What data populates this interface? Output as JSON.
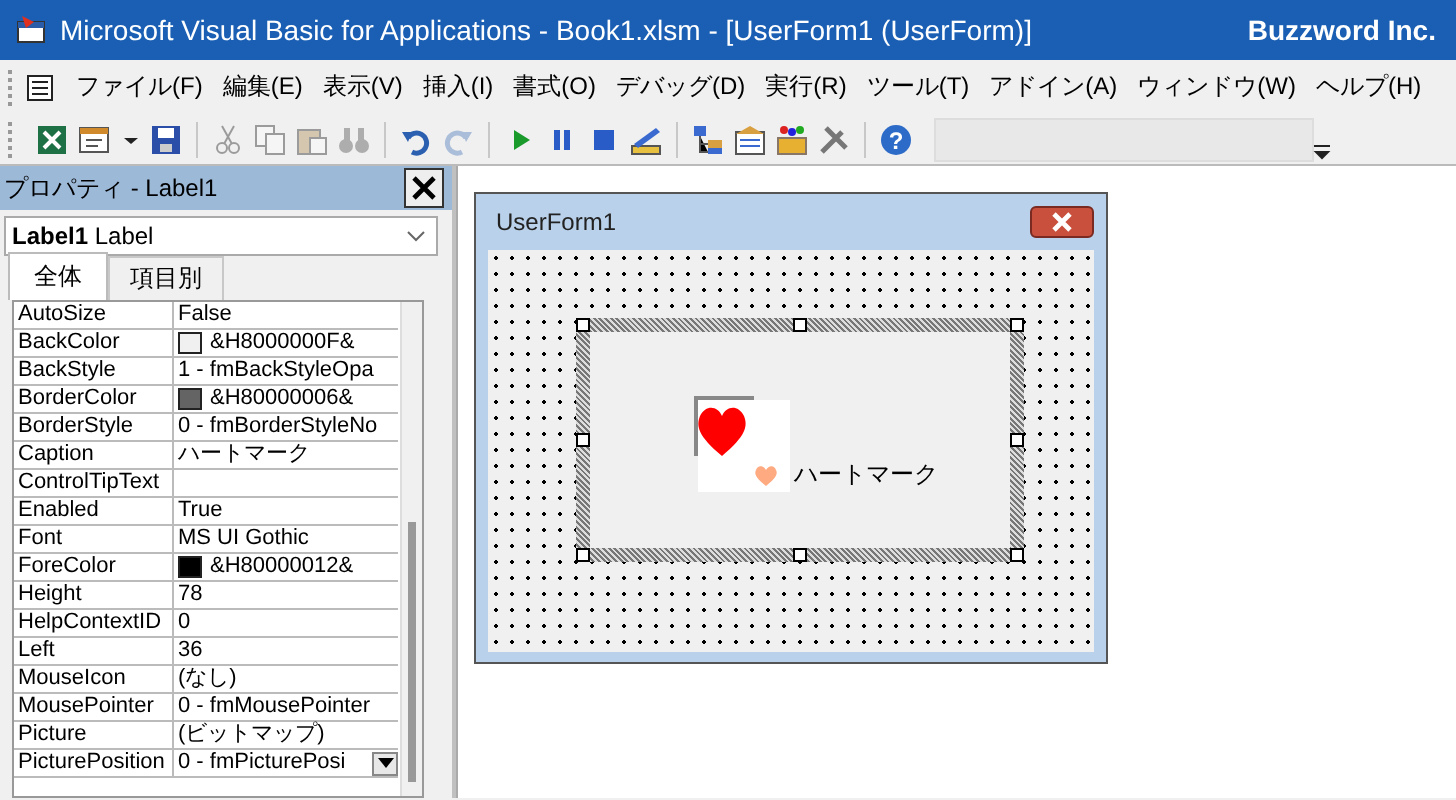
{
  "window": {
    "title": "Microsoft Visual Basic for Applications - Book1.xlsm - [UserForm1 (UserForm)]",
    "brand": "Buzzword Inc."
  },
  "menu": [
    "ファイル(F)",
    "編集(E)",
    "表示(V)",
    "挿入(I)",
    "書式(O)",
    "デバッグ(D)",
    "実行(R)",
    "ツール(T)",
    "アドイン(A)",
    "ウィンドウ(W)",
    "ヘルプ(H)"
  ],
  "toolbar": [
    {
      "kind": "excel",
      "disabled": false
    },
    {
      "kind": "form",
      "disabled": false
    },
    {
      "kind": "caret",
      "disabled": false
    },
    {
      "kind": "save",
      "disabled": false
    },
    {
      "kind": "sep"
    },
    {
      "kind": "cut",
      "disabled": true
    },
    {
      "kind": "copy",
      "disabled": true
    },
    {
      "kind": "paste",
      "disabled": true
    },
    {
      "kind": "find",
      "disabled": true
    },
    {
      "kind": "sep"
    },
    {
      "kind": "undo",
      "disabled": false
    },
    {
      "kind": "redo",
      "disabled": true
    },
    {
      "kind": "sep"
    },
    {
      "kind": "run",
      "disabled": false
    },
    {
      "kind": "pause",
      "disabled": false
    },
    {
      "kind": "stop",
      "disabled": false
    },
    {
      "kind": "design",
      "disabled": false
    },
    {
      "kind": "sep"
    },
    {
      "kind": "project",
      "disabled": false
    },
    {
      "kind": "props",
      "disabled": false
    },
    {
      "kind": "browser",
      "disabled": false
    },
    {
      "kind": "tools",
      "disabled": false
    },
    {
      "kind": "sep"
    },
    {
      "kind": "help",
      "disabled": false,
      "glyph": "?"
    }
  ],
  "properties": {
    "title": "プロパティ - Label1",
    "object": "**Label1** Label",
    "tabs": [
      {
        "label": "全体",
        "selected": true
      },
      {
        "label": "項目別",
        "selected": false
      }
    ],
    "rows": [
      {
        "name": "AutoSize",
        "value": "False"
      },
      {
        "name": "BackColor",
        "value": "&H8000000F&",
        "color": "#f0f0f0"
      },
      {
        "name": "BackStyle",
        "value": "1 - fmBackStyleOpa"
      },
      {
        "name": "BorderColor",
        "value": "&H80000006&",
        "color": "#646464"
      },
      {
        "name": "BorderStyle",
        "value": "0 - fmBorderStyleNo"
      },
      {
        "name": "Caption",
        "value": "ハートマーク"
      },
      {
        "name": "ControlTipText"
      },
      {
        "name": "Enabled",
        "value": "True"
      },
      {
        "name": "Font",
        "value": "MS UI Gothic"
      },
      {
        "name": "ForeColor",
        "value": "&H80000012&",
        "color": "#000000"
      },
      {
        "name": "Height",
        "value": "78"
      },
      {
        "name": "HelpContextID",
        "value": "0"
      },
      {
        "name": "Left",
        "value": "36"
      },
      {
        "name": "MouseIcon",
        "value": "(なし)"
      },
      {
        "name": "MousePointer",
        "value": "0 - fmMousePointer"
      },
      {
        "name": "Picture",
        "value": "(ビットマップ)"
      },
      {
        "name": "PicturePosition",
        "value": "0 - fmPicturePosi",
        "dropdown": true
      }
    ]
  },
  "userform": {
    "title": "UserForm1",
    "label": {
      "caption": "ハートマーク",
      "selected": true
    }
  }
}
